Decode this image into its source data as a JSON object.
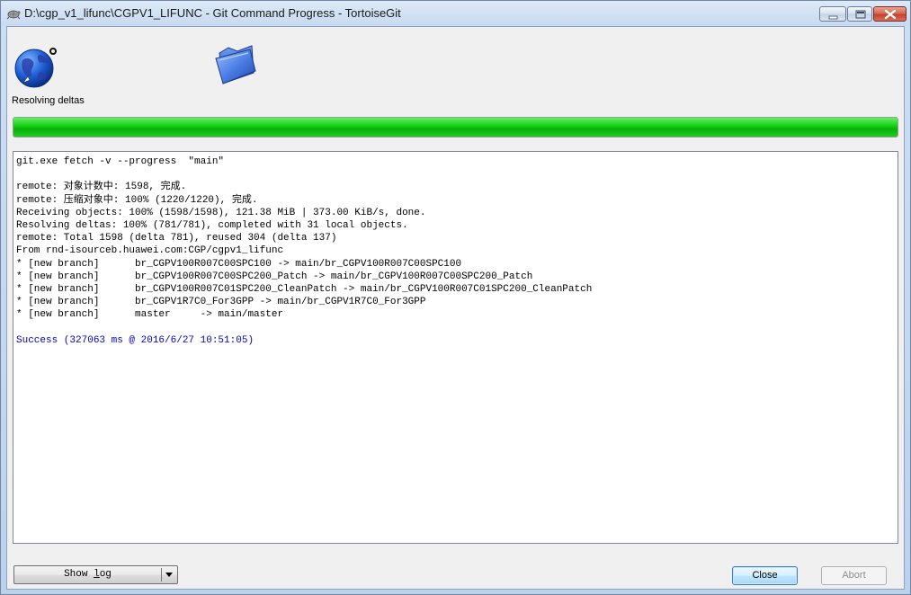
{
  "window": {
    "title": "D:\\cgp_v1_lifunc\\CGPV1_LIFUNC - Git Command Progress - TortoiseGit"
  },
  "status": {
    "text": "Resolving deltas",
    "progress_percent": 100
  },
  "log": {
    "lines": [
      "git.exe fetch -v --progress  \"main\"",
      "",
      "remote: 对象计数中: 1598, 完成.",
      "remote: 压缩对象中: 100% (1220/1220), 完成.",
      "Receiving objects: 100% (1598/1598), 121.38 MiB | 373.00 KiB/s, done.",
      "Resolving deltas: 100% (781/781), completed with 31 local objects.",
      "remote: Total 1598 (delta 781), reused 304 (delta 137)",
      "From rnd-isourceb.huawei.com:CGP/cgpv1_lifunc",
      "* [new branch]      br_CGPV100R007C00SPC100 -> main/br_CGPV100R007C00SPC100",
      "* [new branch]      br_CGPV100R007C00SPC200_Patch -> main/br_CGPV100R007C00SPC200_Patch",
      "* [new branch]      br_CGPV100R007C01SPC200_CleanPatch -> main/br_CGPV100R007C01SPC200_CleanPatch",
      "* [new branch]      br_CGPV1R7C0_For3GPP -> main/br_CGPV1R7C0_For3GPP",
      "* [new branch]      master     -> main/master",
      ""
    ],
    "success_line": "Success (327063 ms @ 2016/6/27 10:51:05)"
  },
  "buttons": {
    "show_log_prefix": "Show ",
    "show_log_underlined": "l",
    "show_log_suffix": "og",
    "close": "Close",
    "abort": "Abort"
  },
  "colors": {
    "progress_fill": "#06b406",
    "success_text": "#0000c8"
  },
  "icons": {
    "app": "tortoisegit-icon",
    "status": "globe-icon",
    "target": "folder-icon",
    "dropdown": "chevron-down-icon"
  }
}
